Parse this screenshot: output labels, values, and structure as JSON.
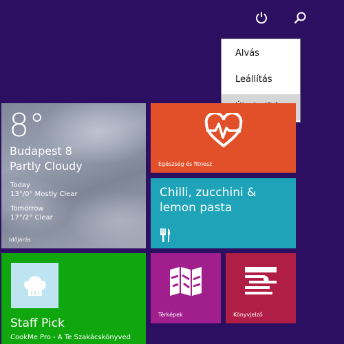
{
  "topbar": {
    "power_icon": "power-icon",
    "search_icon": "search-icon"
  },
  "power_menu": {
    "items": [
      {
        "label": "Alvás"
      },
      {
        "label": "Leállítás"
      },
      {
        "label": "Újraindítás"
      }
    ],
    "selected": "Újraindítás"
  },
  "tiles": {
    "weather": {
      "temperature": "8°",
      "city": "Budapest 8",
      "condition": "Partly Cloudy",
      "today_label": "Today",
      "today_forecast": "13°/0° Mostly Clear",
      "tomorrow_label": "Tomorrow",
      "tomorrow_forecast": "17°/2° Clear",
      "name": "Időjárás"
    },
    "health": {
      "name": "Egészség és fitnesz",
      "icon": "heart-pulse-icon",
      "color": "#e2502a"
    },
    "recipe": {
      "title": "Chilli, zucchini & lemon pasta",
      "icon": "fork-knife-icon",
      "color": "#1ea3b8"
    },
    "staff": {
      "title": "Staff Pick",
      "subtitle": "CookMe Pro - A Te Szakácskönyved",
      "icon": "chef-hat-icon",
      "color": "#10a70e"
    },
    "maps": {
      "name": "Térképek",
      "icon": "map-icon",
      "color": "#a11f8c"
    },
    "news": {
      "name": "Könyvjelző",
      "icon": "bookmark-lines-icon",
      "color": "#b01e45"
    }
  },
  "colors": {
    "background": "#2d0f62",
    "menu_selected": "#d6d6d6"
  }
}
